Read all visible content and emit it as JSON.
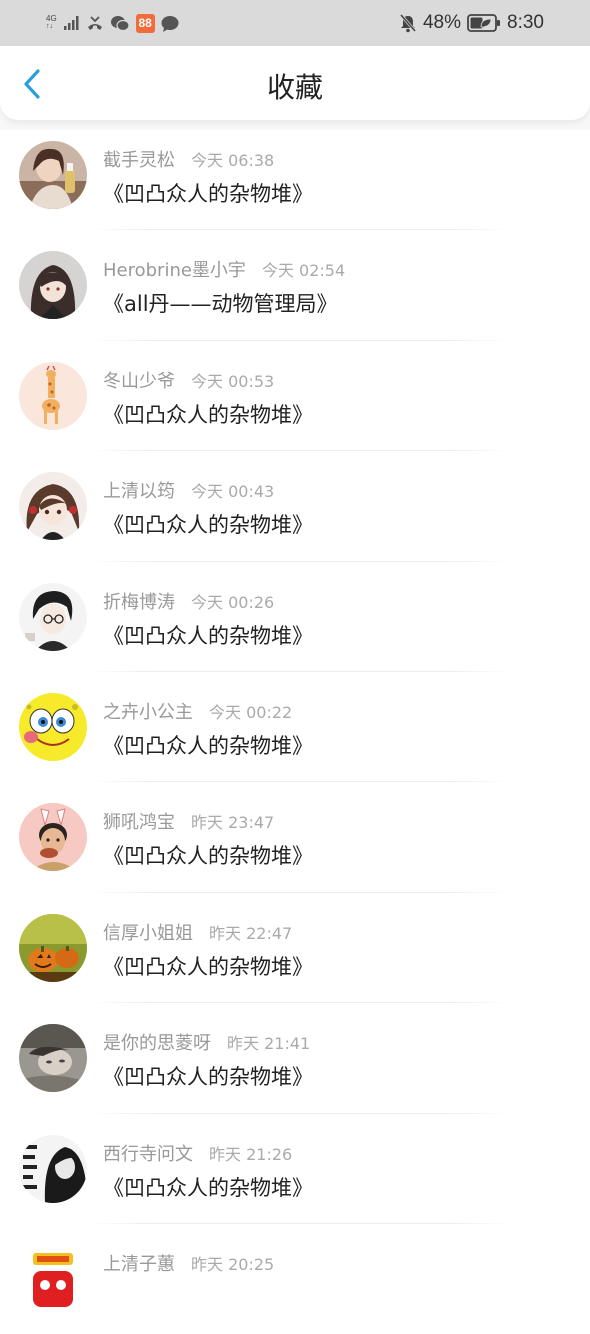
{
  "status_bar": {
    "network_top": "4G",
    "network_bottom": "‹",
    "battery_percent": "48%",
    "time": "8:30",
    "app_badge": "88"
  },
  "header": {
    "title": "收藏"
  },
  "colors": {
    "accent": "#2a9fe0",
    "status_bar_bg": "#dadada"
  },
  "items": [
    {
      "name": "截手灵松",
      "time": "今天 06:38",
      "book": "《凹凸众人的杂物堆》",
      "avatar": "avatar-girl-with-drink"
    },
    {
      "name": "Herobrine墨小宇",
      "time": "今天 02:54",
      "book": "《all丹——动物管理局》",
      "avatar": "avatar-anime-girl-dark"
    },
    {
      "name": "冬山少爷",
      "time": "今天 00:53",
      "book": "《凹凸众人的杂物堆》",
      "avatar": "avatar-giraffe"
    },
    {
      "name": "上清以筠",
      "time": "今天 00:43",
      "book": "《凹凸众人的杂物堆》",
      "avatar": "avatar-anime-girl-brown"
    },
    {
      "name": "折梅博涛",
      "time": "今天 00:26",
      "book": "《凹凸众人的杂物堆》",
      "avatar": "avatar-anime-boy-glasses"
    },
    {
      "name": "之卉小公主",
      "time": "今天 00:22",
      "book": "《凹凸众人的杂物堆》",
      "avatar": "avatar-spongebob"
    },
    {
      "name": "狮吼鸿宝",
      "time": "昨天 23:47",
      "book": "《凹凸众人的杂物堆》",
      "avatar": "avatar-boy-bunny-ears"
    },
    {
      "name": "信厚小姐姐",
      "time": "昨天 22:47",
      "book": "《凹凸众人的杂物堆》",
      "avatar": "avatar-pumpkins"
    },
    {
      "name": "是你的思菱呀",
      "time": "昨天 21:41",
      "book": "《凹凸众人的杂物堆》",
      "avatar": "avatar-woman-lying"
    },
    {
      "name": "西行寺问文",
      "time": "昨天 21:26",
      "book": "《凹凸众人的杂物堆》",
      "avatar": "avatar-text-bw"
    },
    {
      "name": "上清子蕙",
      "time": "昨天 20:25",
      "book": "",
      "avatar": "avatar-red-sticker"
    }
  ]
}
